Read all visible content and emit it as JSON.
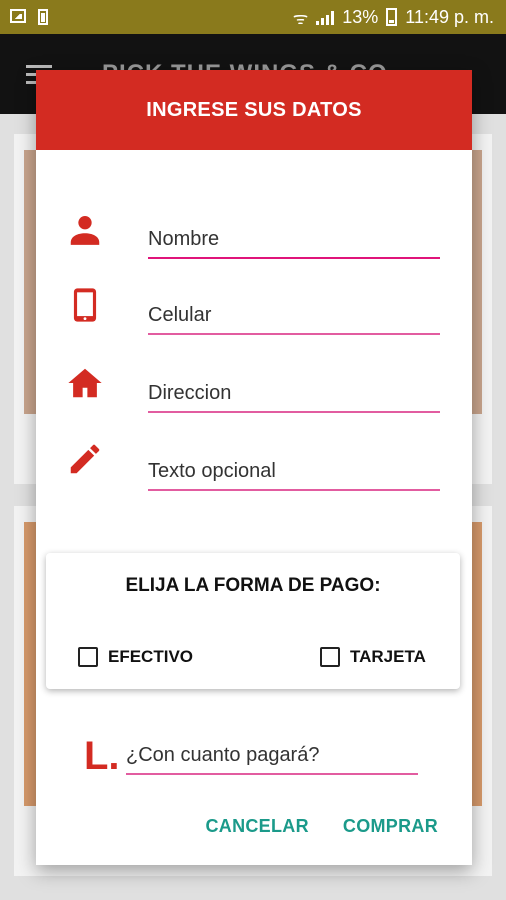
{
  "status_bar": {
    "battery": "13%",
    "time": "11:49 p. m."
  },
  "app_bar": {
    "title": "PICK THE WINGS & CO"
  },
  "dialog": {
    "title": "INGRESE SUS DATOS",
    "fields": {
      "nombre": {
        "placeholder": "Nombre",
        "icon": "person-icon"
      },
      "celular": {
        "placeholder": "Celular",
        "icon": "phone-icon"
      },
      "direccion": {
        "placeholder": "Direccion",
        "icon": "home-icon"
      },
      "texto": {
        "placeholder": "Texto opcional",
        "icon": "pencil-icon"
      }
    },
    "payment": {
      "title": "ELIJA LA FORMA DE PAGO:",
      "options": [
        "EFECTIVO",
        "TARJETA"
      ]
    },
    "amount": {
      "placeholder": "¿Con cuanto pagará?",
      "icon": "L."
    },
    "buttons": {
      "cancel": "CANCELAR",
      "buy": "COMPRAR"
    }
  },
  "colors": {
    "accent": "#d32b22",
    "underline": "#e25ca0",
    "button_text": "#1b9a8a",
    "status_bar": "#8a7a1c"
  }
}
